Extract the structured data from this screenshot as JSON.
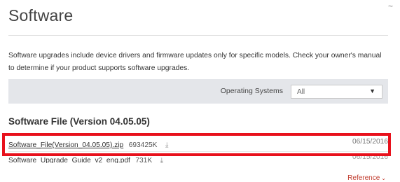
{
  "header": {
    "title": "Software",
    "collapse_glyph": "~"
  },
  "description": "Software upgrades include device drivers and firmware updates only for specific models. Check your owner's manual to determine if your product supports software upgrades.",
  "filter": {
    "label": "Operating Systems",
    "selected": "All",
    "arrow": "▼"
  },
  "section": {
    "heading": "Software File (Version 04.05.05)"
  },
  "files": [
    {
      "name": "Software_File(Version_04.05.05).zip",
      "size": "693425K",
      "date": "06/15/2016",
      "download_glyph": "⤓"
    },
    {
      "name": "Software_Upgrade_Guide_v2_eng.pdf",
      "size": "731K",
      "date": "06/15/2016",
      "download_glyph": "⤓"
    }
  ],
  "reference": {
    "label": "Reference",
    "chevron": "⌄"
  },
  "colors": {
    "highlight": "#e8111c",
    "reference_link": "#c0392b",
    "filter_bar": "#e4e6ea"
  }
}
